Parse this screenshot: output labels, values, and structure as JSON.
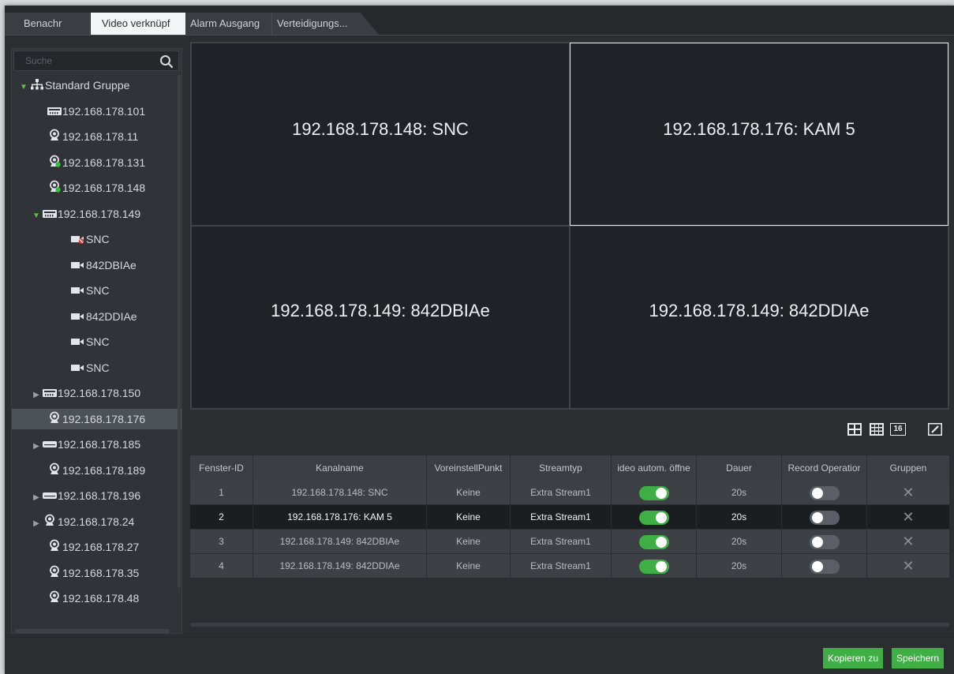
{
  "tabs": [
    "Benachr",
    "Video verknüpf",
    "Alarm Ausgang",
    "Verteidigungs..."
  ],
  "search": {
    "placeholder": "Suche"
  },
  "tree": [
    {
      "label": "Standard Gruppe",
      "icon": "network-group-icon",
      "arrow": "open"
    },
    {
      "label": "192.168.178.101",
      "icon": "nvr-device-icon",
      "arrow": ""
    },
    {
      "label": "192.168.178.11",
      "icon": "camera-icon",
      "arrow": ""
    },
    {
      "label": "192.168.178.131",
      "icon": "camera-online-icon",
      "arrow": ""
    },
    {
      "label": "192.168.178.148",
      "icon": "camera-online-icon",
      "arrow": ""
    },
    {
      "label": "192.168.178.149",
      "icon": "nvr-device-icon",
      "arrow": "open"
    },
    {
      "label": "SNC",
      "icon": "channel-offline-icon",
      "arrow": ""
    },
    {
      "label": "842DBIAe",
      "icon": "channel-icon",
      "arrow": ""
    },
    {
      "label": "SNC",
      "icon": "channel-icon",
      "arrow": ""
    },
    {
      "label": "842DDIAe",
      "icon": "channel-icon",
      "arrow": ""
    },
    {
      "label": "SNC",
      "icon": "channel-icon",
      "arrow": ""
    },
    {
      "label": "SNC",
      "icon": "channel-icon",
      "arrow": ""
    },
    {
      "label": "192.168.178.150",
      "icon": "nvr-device-icon",
      "arrow": "closed"
    },
    {
      "label": "192.168.178.176",
      "icon": "camera-icon",
      "arrow": "",
      "selected": true
    },
    {
      "label": "192.168.178.185",
      "icon": "dvr-device-icon",
      "arrow": "closed"
    },
    {
      "label": "192.168.178.189",
      "icon": "camera-icon",
      "arrow": ""
    },
    {
      "label": "192.168.178.196",
      "icon": "dvr-device-icon",
      "arrow": "closed"
    },
    {
      "label": "192.168.178.24",
      "icon": "camera-icon",
      "arrow": "closed"
    },
    {
      "label": "192.168.178.27",
      "icon": "camera-icon",
      "arrow": ""
    },
    {
      "label": "192.168.178.35",
      "icon": "camera-icon",
      "arrow": ""
    },
    {
      "label": "192.168.178.48",
      "icon": "camera-icon",
      "arrow": ""
    }
  ],
  "video_windows": [
    "192.168.178.148: SNC",
    "192.168.178.176: KAM 5",
    "192.168.178.149: 842DBIAe",
    "192.168.178.149: 842DDIAe"
  ],
  "layout_buttons": {
    "grid4": "layout-4-icon",
    "grid9": "layout-9-icon",
    "grid16": "16",
    "edit": "edit-pencil-icon"
  },
  "table": {
    "headers": [
      "Fenster-ID",
      "Kanalname",
      "VoreinstellPunkt",
      "Streamtyp",
      "ideo autom. öffne",
      "Dauer",
      "Record Operatior",
      "Gruppen"
    ],
    "rows": [
      {
        "id": "1",
        "name": "192.168.178.148: SNC",
        "preset": "Keine",
        "stream": "Extra Stream1",
        "auto_open": true,
        "duration": "20s",
        "record": false
      },
      {
        "id": "2",
        "name": "192.168.178.176: KAM 5",
        "preset": "Keine",
        "stream": "Extra Stream1",
        "auto_open": true,
        "duration": "20s",
        "record": false
      },
      {
        "id": "3",
        "name": "192.168.178.149: 842DBIAe",
        "preset": "Keine",
        "stream": "Extra Stream1",
        "auto_open": true,
        "duration": "20s",
        "record": false
      },
      {
        "id": "4",
        "name": "192.168.178.149: 842DDIAe",
        "preset": "Keine",
        "stream": "Extra Stream1",
        "auto_open": true,
        "duration": "20s",
        "record": false
      }
    ],
    "selected_row": 2
  },
  "buttons": {
    "copy": "Kopieren zu",
    "save": "Speichern"
  },
  "colors": {
    "accent_green": "#3fae45",
    "background": "#2b2e31",
    "video_bg": "#1f2226"
  }
}
